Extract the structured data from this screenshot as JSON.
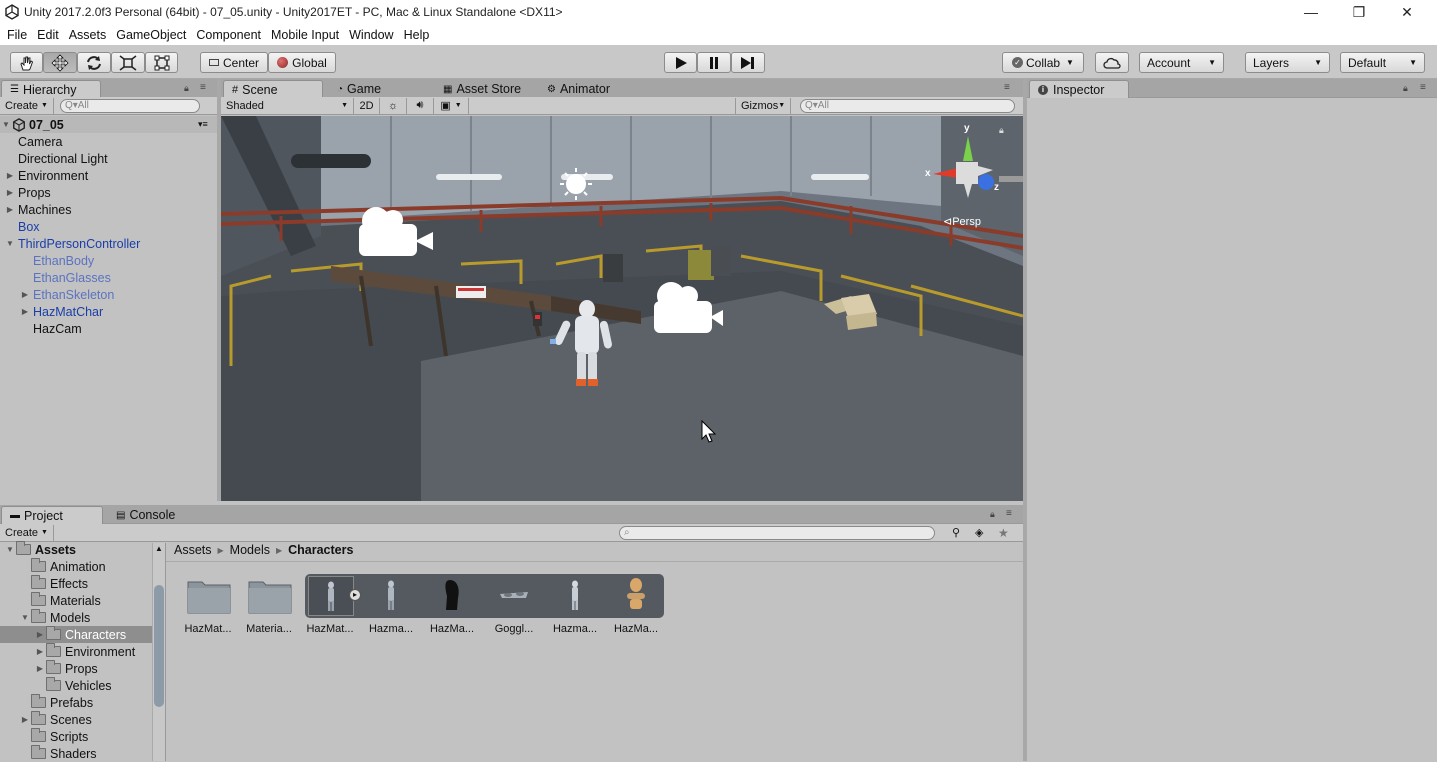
{
  "window": {
    "title": "Unity 2017.2.0f3 Personal (64bit) - 07_05.unity - Unity2017ET - PC, Mac & Linux Standalone <DX11>",
    "minimize": "—",
    "restore": "❐",
    "close": "✕"
  },
  "menu": [
    "File",
    "Edit",
    "Assets",
    "GameObject",
    "Component",
    "Mobile Input",
    "Window",
    "Help"
  ],
  "toolbar": {
    "pivot": "Center",
    "space": "Global",
    "collab": "Collab",
    "account": "Account",
    "layers": "Layers",
    "layout": "Default"
  },
  "hierarchy": {
    "tab": "Hierarchy",
    "create": "Create",
    "search_placeholder": "Q▾All",
    "scene_name": "07_05",
    "items": [
      {
        "label": "Camera",
        "indent": 0,
        "arrow": "",
        "style": "normal"
      },
      {
        "label": "Directional Light",
        "indent": 0,
        "arrow": "",
        "style": "normal"
      },
      {
        "label": "Environment",
        "indent": 0,
        "arrow": "▶",
        "style": "normal"
      },
      {
        "label": "Props",
        "indent": 0,
        "arrow": "▶",
        "style": "normal"
      },
      {
        "label": "Machines",
        "indent": 0,
        "arrow": "▶",
        "style": "normal"
      },
      {
        "label": "Box",
        "indent": 0,
        "arrow": "",
        "style": "blue"
      },
      {
        "label": "ThirdPersonController",
        "indent": 0,
        "arrow": "▼",
        "style": "blue"
      },
      {
        "label": "EthanBody",
        "indent": 1,
        "arrow": "",
        "style": "lblue"
      },
      {
        "label": "EthanGlasses",
        "indent": 1,
        "arrow": "",
        "style": "lblue"
      },
      {
        "label": "EthanSkeleton",
        "indent": 1,
        "arrow": "▶",
        "style": "lblue"
      },
      {
        "label": "HazMatChar",
        "indent": 1,
        "arrow": "▶",
        "style": "blue"
      },
      {
        "label": "HazCam",
        "indent": 1,
        "arrow": "",
        "style": "normal"
      }
    ]
  },
  "center_tabs": {
    "scene": "Scene",
    "game": "Game",
    "asset_store": "Asset Store",
    "animator": "Animator"
  },
  "scene_bar": {
    "shading": "Shaded",
    "mode2d": "2D",
    "gizmos": "Gizmos",
    "search_placeholder": "Q▾All"
  },
  "scene_gizmo": {
    "y": "y",
    "x": "x",
    "z": "z",
    "persp": "Persp"
  },
  "inspector": {
    "tab": "Inspector"
  },
  "project": {
    "tab": "Project",
    "console_tab": "Console",
    "create": "Create",
    "breadcrumb": [
      "Assets",
      "Models",
      "Characters"
    ],
    "tree": [
      {
        "label": "Assets",
        "indent": 0,
        "arrow": "▼",
        "bold": true,
        "selected": false
      },
      {
        "label": "Animation",
        "indent": 1,
        "arrow": "",
        "bold": false,
        "selected": false
      },
      {
        "label": "Effects",
        "indent": 1,
        "arrow": "",
        "bold": false,
        "selected": false
      },
      {
        "label": "Materials",
        "indent": 1,
        "arrow": "",
        "bold": false,
        "selected": false
      },
      {
        "label": "Models",
        "indent": 1,
        "arrow": "▼",
        "bold": false,
        "selected": false
      },
      {
        "label": "Characters",
        "indent": 2,
        "arrow": "▶",
        "bold": false,
        "selected": true
      },
      {
        "label": "Environment",
        "indent": 2,
        "arrow": "▶",
        "bold": false,
        "selected": false
      },
      {
        "label": "Props",
        "indent": 2,
        "arrow": "▶",
        "bold": false,
        "selected": false
      },
      {
        "label": "Vehicles",
        "indent": 2,
        "arrow": "",
        "bold": false,
        "selected": false
      },
      {
        "label": "Prefabs",
        "indent": 1,
        "arrow": "",
        "bold": false,
        "selected": false
      },
      {
        "label": "Scenes",
        "indent": 1,
        "arrow": "▶",
        "bold": false,
        "selected": false
      },
      {
        "label": "Scripts",
        "indent": 1,
        "arrow": "",
        "bold": false,
        "selected": false
      },
      {
        "label": "Shaders",
        "indent": 1,
        "arrow": "",
        "bold": false,
        "selected": false
      }
    ],
    "assets": [
      {
        "label": "HazMat...",
        "kind": "folder"
      },
      {
        "label": "Materia...",
        "kind": "folder"
      },
      {
        "label": "HazMat...",
        "kind": "model-selected"
      },
      {
        "label": "Hazma...",
        "kind": "figure"
      },
      {
        "label": "HazMa...",
        "kind": "shape"
      },
      {
        "label": "Goggl...",
        "kind": "goggles"
      },
      {
        "label": "Hazma...",
        "kind": "figure"
      },
      {
        "label": "HazMa...",
        "kind": "avatar"
      }
    ]
  }
}
